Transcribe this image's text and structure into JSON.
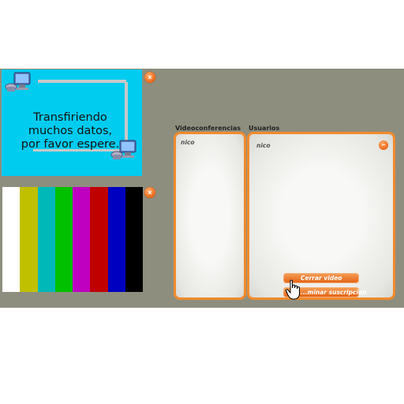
{
  "transfer_panel": {
    "message_line1": "Transfiriendo",
    "message_line2": "muchos datos,",
    "message_line3": "por favor espere.",
    "background_color": "#00ccf0",
    "close_label": "×"
  },
  "color_bars_panel": {
    "colors": [
      "#ffffff",
      "#c0c000",
      "#00b8b8",
      "#00c000",
      "#c000c0",
      "#c00000",
      "#0000c0",
      "#000000"
    ],
    "close_label": "×"
  },
  "videoconferences": {
    "heading": "Videoconferencias",
    "user_name": "nico"
  },
  "users": {
    "heading": "Usuarios",
    "user_name": "nico",
    "collapse_label": "–",
    "close_video_label": "Cerrar video",
    "unsubscribe_label": "...minar suscripcion"
  },
  "colors": {
    "accent": "#f28a2b",
    "stage_background": "#8e8e7e"
  }
}
